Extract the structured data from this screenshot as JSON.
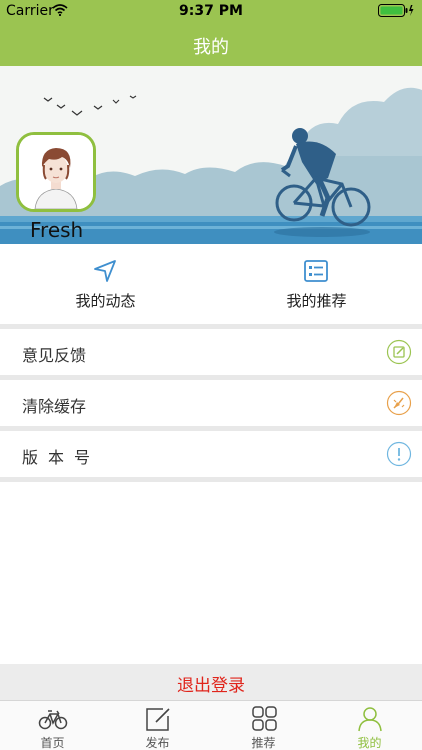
{
  "status_bar": {
    "carrier": "Carrier",
    "time": "9:37 PM"
  },
  "nav": {
    "title": "我的"
  },
  "profile": {
    "username": "Fresh"
  },
  "quick_actions": [
    {
      "label": "我的动态",
      "icon": "navigation-arrow-icon"
    },
    {
      "label": "我的推荐",
      "icon": "list-card-icon"
    }
  ],
  "menu": [
    {
      "label": "意见反馈",
      "icon": "edit-icon",
      "color": "#9bc451"
    },
    {
      "label": "清除缓存",
      "icon": "broom-icon",
      "color": "#e8a04a"
    },
    {
      "label": "版本号",
      "icon": "info-icon",
      "color": "#6fb6e0"
    }
  ],
  "logout": {
    "label": "退出登录",
    "color": "#e0241b"
  },
  "tabs": [
    {
      "label": "首页",
      "icon": "bicycle-icon",
      "active": false
    },
    {
      "label": "发布",
      "icon": "compose-icon",
      "active": false
    },
    {
      "label": "推荐",
      "icon": "grid-icon",
      "active": false
    },
    {
      "label": "我的",
      "icon": "person-icon",
      "active": true
    }
  ],
  "colors": {
    "theme": "#9bc451",
    "accent": "#8fbf3f",
    "danger": "#e0241b"
  }
}
